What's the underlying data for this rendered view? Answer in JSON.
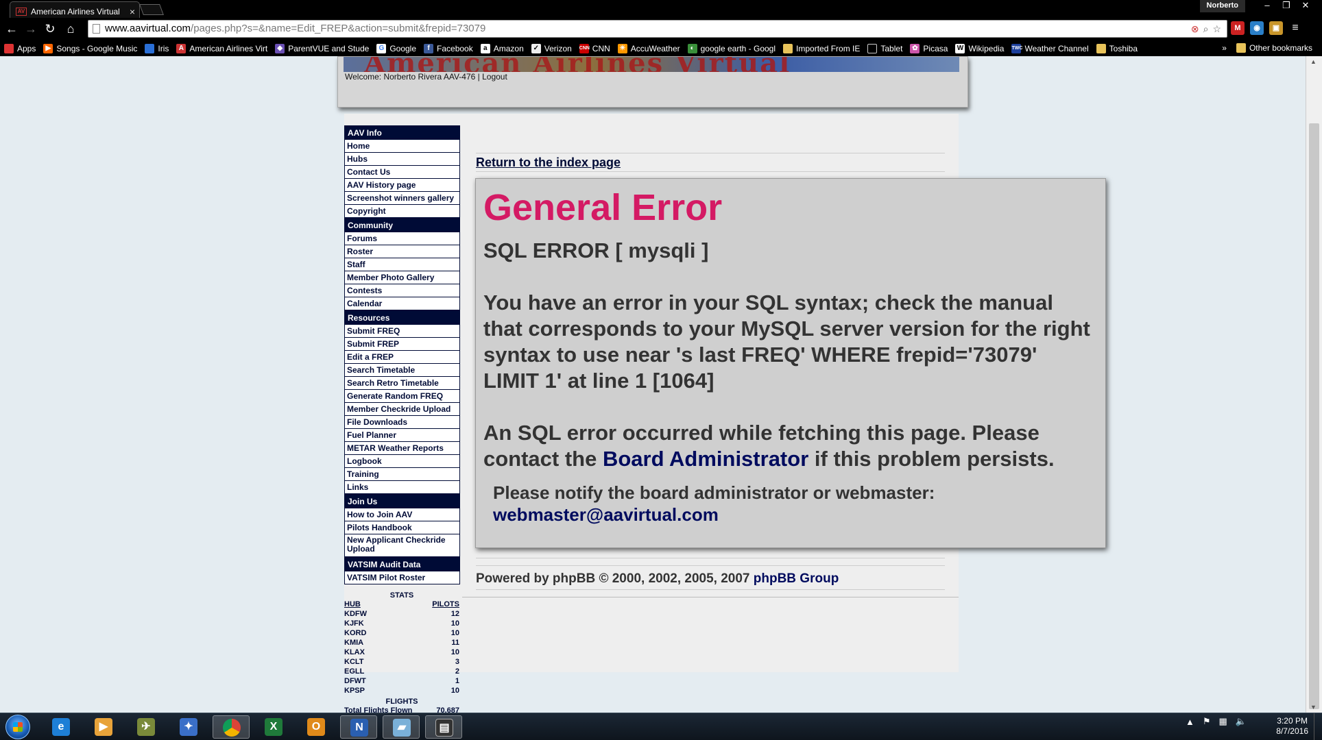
{
  "browser": {
    "tab_title": "American Airlines Virtual",
    "user_name": "Norberto",
    "url_host": "www.aavirtual.com",
    "url_path": "/pages.php?s=&name=Edit_FREP&action=submit&frepid=73079"
  },
  "bookmarks": [
    {
      "label": "Apps",
      "icon": "apps-grid-icon",
      "color": "#d33"
    },
    {
      "label": "Songs - Google Music",
      "icon": "play-icon",
      "color": "#f60"
    },
    {
      "label": "Iris",
      "icon": "iris-icon",
      "color": "#2a6fd6"
    },
    {
      "label": "American Airlines Virt",
      "icon": "aav-icon",
      "color": "#c33"
    },
    {
      "label": "ParentVUE and Stude",
      "icon": "parentvue-icon",
      "color": "#6a4fb3"
    },
    {
      "label": "Google",
      "icon": "google-icon",
      "color": "#4285f4"
    },
    {
      "label": "Facebook",
      "icon": "facebook-icon",
      "color": "#3b5998"
    },
    {
      "label": "Amazon",
      "icon": "amazon-icon",
      "color": "#222"
    },
    {
      "label": "Verizon",
      "icon": "verizon-icon",
      "color": "#888"
    },
    {
      "label": "CNN",
      "icon": "cnn-icon",
      "color": "#cc0000"
    },
    {
      "label": "AccuWeather",
      "icon": "accuweather-icon",
      "color": "#f90"
    },
    {
      "label": "google earth - Googl",
      "icon": "google-earth-icon",
      "color": "#3a8f3a"
    },
    {
      "label": "Imported From IE",
      "icon": "folder-icon",
      "color": "#e8c35a"
    },
    {
      "label": "Tablet",
      "icon": "page-icon",
      "color": "#ccc"
    },
    {
      "label": "Picasa",
      "icon": "picasa-icon",
      "color": "#c5a"
    },
    {
      "label": "Wikipedia",
      "icon": "wikipedia-icon",
      "color": "#ddd"
    },
    {
      "label": "Weather Channel",
      "icon": "weather-channel-icon",
      "color": "#1c3f9c"
    },
    {
      "label": "Toshiba",
      "icon": "folder-icon",
      "color": "#e8c35a"
    }
  ],
  "bookmarks_more": "»",
  "other_bookmarks": "Other bookmarks",
  "site": {
    "welcome_text": "Welcome: Norberto Rivera AAV-476 |",
    "logout_label": "Logout",
    "banner_text": "American Airlines Virtual"
  },
  "sidebar": [
    {
      "heading": "AAV Info",
      "items": [
        "Home",
        "Hubs",
        "Contact Us",
        "AAV History page",
        "Screenshot winners gallery",
        "Copyright"
      ]
    },
    {
      "heading": "Community",
      "items": [
        "Forums",
        "Roster",
        "Staff",
        "Member Photo Gallery",
        "Contests",
        "Calendar"
      ]
    },
    {
      "heading": "Resources",
      "items": [
        "Submit FREQ",
        "Submit FREP",
        "Edit a FREP",
        "Search Timetable",
        "Search Retro Timetable",
        "Generate Random FREQ",
        "Member Checkride Upload",
        "File Downloads",
        "Fuel Planner",
        "METAR Weather Reports",
        "Logbook",
        "Training",
        "Links"
      ]
    },
    {
      "heading": "Join Us",
      "items": [
        "How to Join AAV",
        "Pilots Handbook",
        "New Applicant Checkride Upload"
      ]
    },
    {
      "heading": "VATSIM Audit Data",
      "items": [
        "VATSIM Pilot Roster"
      ]
    }
  ],
  "stats": {
    "title": "STATS",
    "hub_header": "HUB",
    "pilots_header": "PILOTS",
    "rows": [
      {
        "hub": "KDFW",
        "pilots": "12"
      },
      {
        "hub": "KJFK",
        "pilots": "10"
      },
      {
        "hub": "KORD",
        "pilots": "10"
      },
      {
        "hub": "KMIA",
        "pilots": "11"
      },
      {
        "hub": "KLAX",
        "pilots": "10"
      },
      {
        "hub": "KCLT",
        "pilots": "3"
      },
      {
        "hub": "EGLL",
        "pilots": "2"
      },
      {
        "hub": "DFWT",
        "pilots": "1"
      },
      {
        "hub": "KPSP",
        "pilots": "10"
      }
    ],
    "flights_title": "FLIGHTS",
    "total_flights_label": "Total Flights Flown",
    "total_flights_value": "70,687"
  },
  "main": {
    "return_link": "Return to the index page",
    "error_title": "General Error",
    "error_type": "SQL ERROR [ mysqli ]",
    "error_message": "You have an error in your SQL syntax; check the manual that corresponds to your MySQL server version for the right syntax to use near 's last FREQ' WHERE frepid='73079' LIMIT 1' at line 1 [1064]",
    "error_occurred_pre": "An SQL error occurred while fetching this page. Please contact the",
    "board_admin_link": "Board Administrator",
    "error_occurred_post": "if this problem persists.",
    "notify_text": "Please notify the board administrator or webmaster:",
    "webmaster_email": "webmaster@aavirtual.com",
    "powered_pre": "Powered by phpBB © 2000, 2002, 2005, 2007",
    "phpbb_link": "phpBB Group"
  },
  "taskbar": {
    "apps": [
      {
        "name": "internet-explorer",
        "glyph": "e",
        "color": "#1e7fd6"
      },
      {
        "name": "media-player",
        "glyph": "▶",
        "color": "#e8a33a"
      },
      {
        "name": "flight-sim",
        "glyph": "✈",
        "color": "#7a8a3a"
      },
      {
        "name": "star-app",
        "glyph": "✦",
        "color": "#3a6fc8"
      },
      {
        "name": "chrome",
        "glyph": "●",
        "color": "#3aa04a"
      },
      {
        "name": "excel",
        "glyph": "X",
        "color": "#1f7a3a"
      },
      {
        "name": "outlook",
        "glyph": "O",
        "color": "#e08a1a"
      },
      {
        "name": "onenote",
        "glyph": "N",
        "color": "#2a5fb0"
      },
      {
        "name": "notebook",
        "glyph": "▰",
        "color": "#7ab0d8"
      },
      {
        "name": "terminal",
        "glyph": "▤",
        "color": "#333"
      }
    ],
    "time": "3:20 PM",
    "date": "8/7/2016"
  }
}
